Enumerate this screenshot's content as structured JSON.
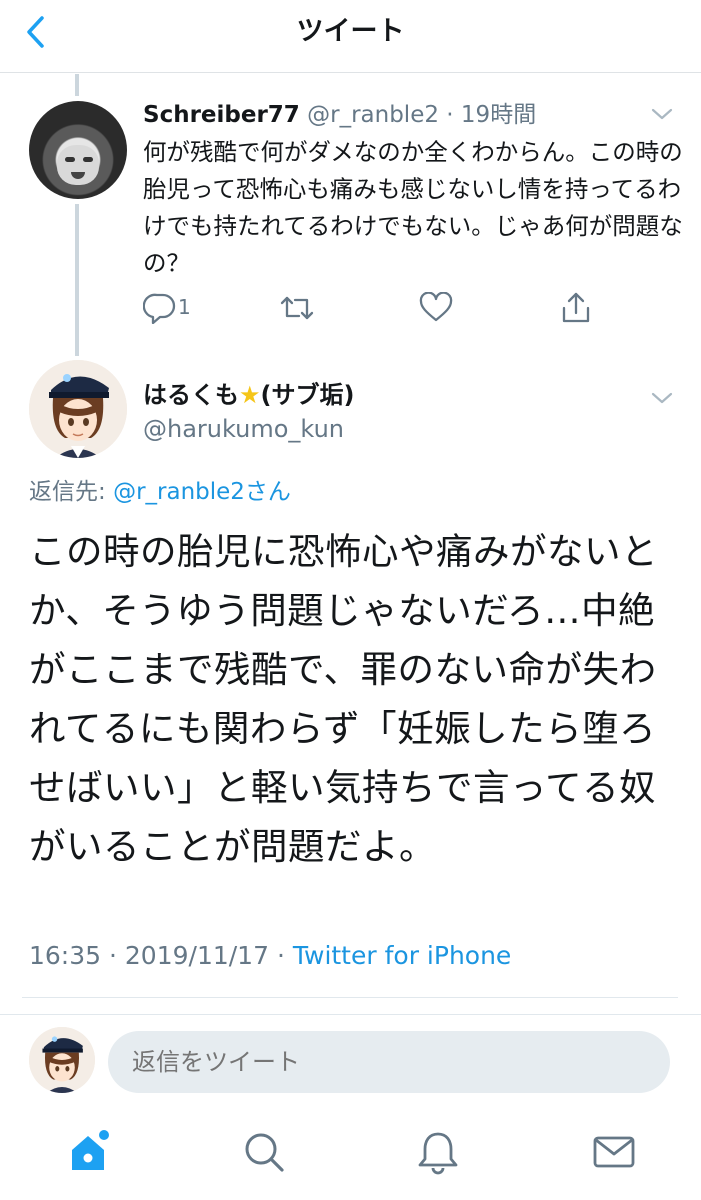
{
  "header": {
    "title": "ツイート"
  },
  "parent_tweet": {
    "name": "Schreiber77",
    "handle": "@r_ranble2",
    "time": "19時間",
    "text": "何が残酷で何がダメなのか全くわからん。この時の胎児って恐怖心も痛みも感じないし情を持ってるわけでも持たれてるわけでもない。じゃあ何が問題なの？",
    "reply_count": "1"
  },
  "main_tweet": {
    "name": "はるくも",
    "name_suffix": "(サブ垢)",
    "handle": "@harukumo_kun",
    "reply_to_label": "返信先:",
    "reply_to_target": "@r_ranble2さん",
    "text": "この時の胎児に恐怖心や痛みがないとか、そうゆう問題じゃないだろ…中絶がここまで残酷で、罪のない命が失われてるにも関わらず「妊娠したら堕ろせばいい」と軽い気持ちで言ってる奴がいることが問題だよ。",
    "time": "16:35",
    "date": "2019/11/17",
    "source": "Twitter for iPhone"
  },
  "compose": {
    "placeholder": "返信をツイート"
  },
  "colors": {
    "accent": "#1da1f2",
    "link": "#1b95e0",
    "muted": "#657786"
  },
  "tabs": [
    "home-icon",
    "search-icon",
    "notifications-icon",
    "messages-icon"
  ]
}
